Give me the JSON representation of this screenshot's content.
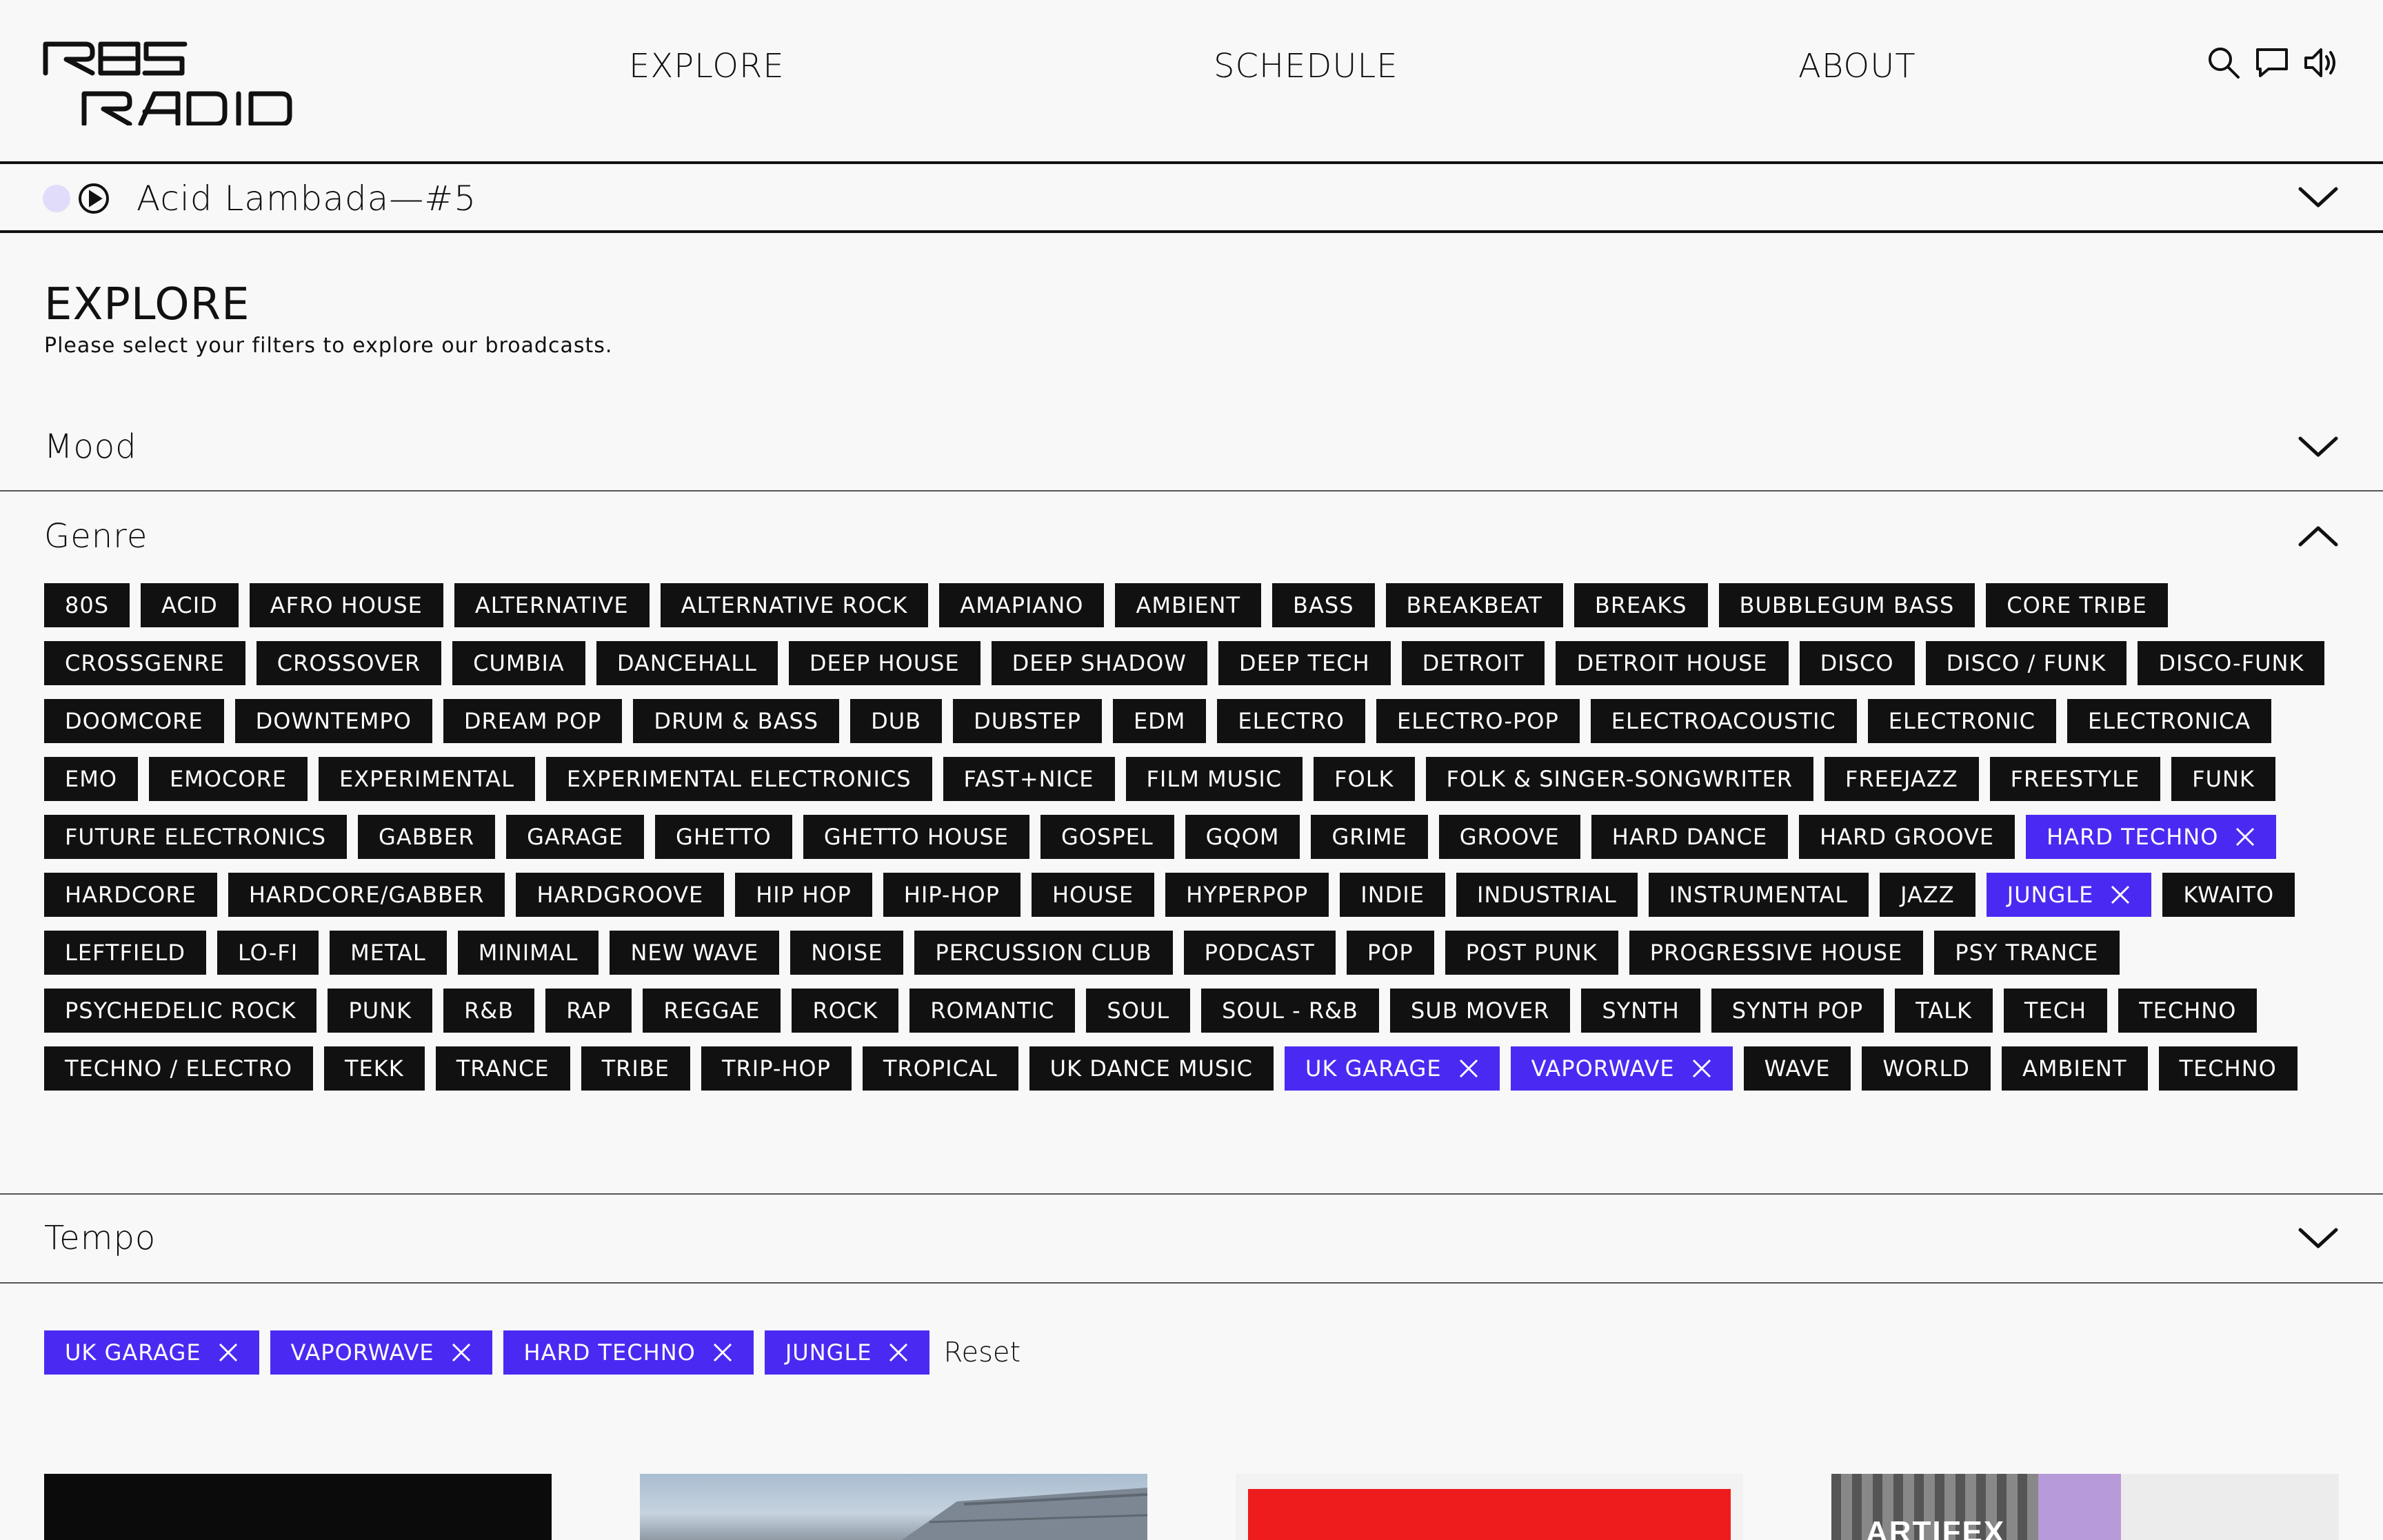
{
  "header": {
    "logo_text": "res radio",
    "nav": [
      "EXPLORE",
      "SCHEDULE",
      "ABOUT"
    ],
    "icons": [
      "search-icon",
      "chat-icon",
      "volume-icon"
    ]
  },
  "player": {
    "now_playing": "Acid Lambada—#5",
    "indicator_color": "#e2dcfb"
  },
  "explore": {
    "title": "EXPLORE",
    "subtitle": "Please select your filters to explore our broadcasts."
  },
  "sections": {
    "mood": "Mood",
    "genre": "Genre",
    "tempo": "Tempo"
  },
  "genres": [
    {
      "label": "80S"
    },
    {
      "label": "ACID"
    },
    {
      "label": "AFRO HOUSE"
    },
    {
      "label": "ALTERNATIVE"
    },
    {
      "label": "ALTERNATIVE ROCK"
    },
    {
      "label": "AMAPIANO"
    },
    {
      "label": "AMBIENT"
    },
    {
      "label": "BASS"
    },
    {
      "label": "BREAKBEAT"
    },
    {
      "label": "BREAKS"
    },
    {
      "label": "BUBBLEGUM BASS"
    },
    {
      "label": "CORE TRIBE"
    },
    {
      "label": "CROSSGENRE"
    },
    {
      "label": "CROSSOVER"
    },
    {
      "label": "CUMBIA"
    },
    {
      "label": "DANCEHALL"
    },
    {
      "label": "DEEP HOUSE"
    },
    {
      "label": "DEEP SHADOW"
    },
    {
      "label": "DEEP TECH"
    },
    {
      "label": "DETROIT"
    },
    {
      "label": "DETROIT HOUSE"
    },
    {
      "label": "DISCO"
    },
    {
      "label": "DISCO / FUNK"
    },
    {
      "label": "DISCO-FUNK"
    },
    {
      "label": "DOOMCORE"
    },
    {
      "label": "DOWNTEMPO"
    },
    {
      "label": "DREAM POP"
    },
    {
      "label": "DRUM & BASS"
    },
    {
      "label": "DUB"
    },
    {
      "label": "DUBSTEP"
    },
    {
      "label": "EDM"
    },
    {
      "label": "ELECTRO"
    },
    {
      "label": "ELECTRO-POP"
    },
    {
      "label": "ELECTROACOUSTIC"
    },
    {
      "label": "ELECTRONIC"
    },
    {
      "label": "ELECTRONICA"
    },
    {
      "label": "EMO"
    },
    {
      "label": "EMOCORE"
    },
    {
      "label": "EXPERIMENTAL"
    },
    {
      "label": "EXPERIMENTAL ELECTRONICS"
    },
    {
      "label": "FAST+NICE"
    },
    {
      "label": "FILM MUSIC"
    },
    {
      "label": "FOLK"
    },
    {
      "label": "FOLK & SINGER-SONGWRITER"
    },
    {
      "label": "FREEJAZZ"
    },
    {
      "label": "FREESTYLE"
    },
    {
      "label": "FUNK"
    },
    {
      "label": "FUTURE ELECTRONICS"
    },
    {
      "label": "GABBER"
    },
    {
      "label": "GARAGE"
    },
    {
      "label": "GHETTO"
    },
    {
      "label": "GHETTO HOUSE"
    },
    {
      "label": "GOSPEL"
    },
    {
      "label": "GQOM"
    },
    {
      "label": "GRIME"
    },
    {
      "label": "GROOVE"
    },
    {
      "label": "HARD DANCE"
    },
    {
      "label": "HARD GROOVE"
    },
    {
      "label": "HARD TECHNO",
      "selected": true
    },
    {
      "label": "HARDCORE"
    },
    {
      "label": "HARDCORE/GABBER"
    },
    {
      "label": "HARDGROOVE"
    },
    {
      "label": "HIP HOP"
    },
    {
      "label": "HIP-HOP"
    },
    {
      "label": "HOUSE"
    },
    {
      "label": "HYPERPOP"
    },
    {
      "label": "INDIE"
    },
    {
      "label": "INDUSTRIAL"
    },
    {
      "label": "INSTRUMENTAL"
    },
    {
      "label": "JAZZ"
    },
    {
      "label": "JUNGLE",
      "selected": true
    },
    {
      "label": "KWAITO"
    },
    {
      "label": "LEFTFIELD"
    },
    {
      "label": "LO-FI"
    },
    {
      "label": "METAL"
    },
    {
      "label": "MINIMAL"
    },
    {
      "label": "NEW WAVE"
    },
    {
      "label": "NOISE"
    },
    {
      "label": "PERCUSSION CLUB"
    },
    {
      "label": "PODCAST"
    },
    {
      "label": "POP"
    },
    {
      "label": "POST PUNK"
    },
    {
      "label": "PROGRESSIVE HOUSE"
    },
    {
      "label": "PSY TRANCE"
    },
    {
      "label": "PSYCHEDELIC ROCK"
    },
    {
      "label": "PUNK"
    },
    {
      "label": "R&B"
    },
    {
      "label": "RAP"
    },
    {
      "label": "REGGAE"
    },
    {
      "label": "ROCK"
    },
    {
      "label": "ROMANTIC"
    },
    {
      "label": "SOUL"
    },
    {
      "label": "SOUL - R&B"
    },
    {
      "label": "SUB MOVER"
    },
    {
      "label": "SYNTH"
    },
    {
      "label": "SYNTH POP"
    },
    {
      "label": "TALK"
    },
    {
      "label": "TECH"
    },
    {
      "label": "TECHNO"
    },
    {
      "label": "TECHNO / ELECTRO"
    },
    {
      "label": "TEKK"
    },
    {
      "label": "TRANCE"
    },
    {
      "label": "TRIBE"
    },
    {
      "label": "TRIP-HOP"
    },
    {
      "label": "TROPICAL"
    },
    {
      "label": "UK DANCE MUSIC"
    },
    {
      "label": "UK GARAGE",
      "selected": true
    },
    {
      "label": "VAPORWAVE",
      "selected": true
    },
    {
      "label": "WAVE"
    },
    {
      "label": "WORLD"
    },
    {
      "label": "AMBIENT"
    },
    {
      "label": "TECHNO"
    }
  ],
  "active_filters": [
    "UK GARAGE",
    "VAPORWAVE",
    "HARD TECHNO",
    "JUNGLE"
  ],
  "reset_label": "Reset",
  "colors": {
    "accent": "#4a2af2",
    "tag_bg": "#111111",
    "page_bg": "#f8f8f8"
  },
  "cards": [
    {
      "name": "broadcast-card-1-thumbnail"
    },
    {
      "name": "broadcast-card-2-thumbnail"
    },
    {
      "name": "broadcast-card-3-thumbnail"
    },
    {
      "name": "broadcast-card-4-thumbnail",
      "text": "ARTIFEX"
    }
  ]
}
